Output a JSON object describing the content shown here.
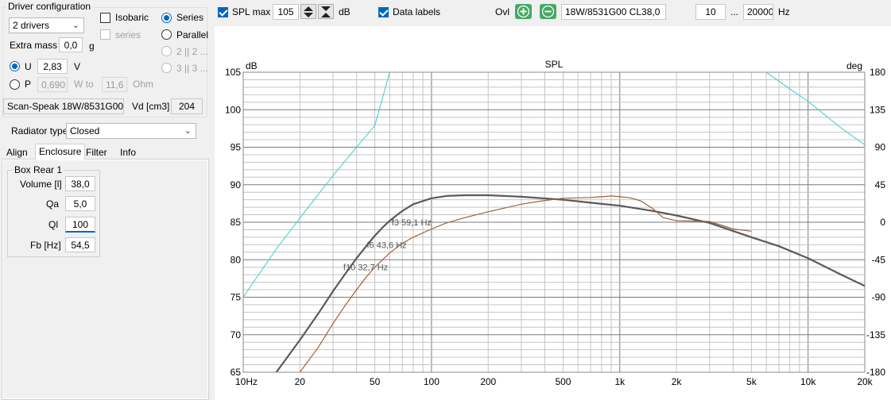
{
  "left_panel": {
    "driver_config": {
      "title": "Driver configuration",
      "drivers_combo": "2 drivers",
      "isobaric_label": "Isobaric",
      "series_sub_label": "series",
      "series_label": "Series",
      "parallel_label": "Parallel",
      "opt_2x2_label": "2 || 2 ...",
      "opt_3x3_label": "3 || 3 ...",
      "extra_mass_label": "Extra mass",
      "extra_mass_value": "0,0",
      "extra_mass_unit": "g",
      "u_label": "U",
      "u_value": "2,83",
      "u_unit": "V",
      "p_label": "P",
      "p_value": "0,690",
      "w_to_label": "W to",
      "ohm_value": "11,6",
      "ohm_unit": "Ohm"
    },
    "driver_name": "Scan-Speak 18W/8531G00",
    "vd_label": "Vd [cm3]",
    "vd_value": "204",
    "radiator_label": "Radiator type",
    "radiator_value": "Closed",
    "tabs": [
      "Align",
      "Enclosure",
      "Filter",
      "Info"
    ],
    "box": {
      "title": "Box Rear 1",
      "volume_label": "Volume [l]",
      "volume_value": "38,0",
      "qa_label": "Qa",
      "qa_value": "5,0",
      "ql_label": "Ql",
      "ql_value": "100",
      "fb_label": "Fb [Hz]",
      "fb_value": "54,5"
    }
  },
  "toolbar": {
    "spl_max_label": "SPL max",
    "spl_max_value": "105",
    "db_unit": "dB",
    "data_labels_label": "Data labels",
    "ovl_label": "Ovl",
    "overlay_name": "18W/8531G00 CL38,0",
    "freq_min": "10",
    "dots": "...",
    "freq_max": "20000",
    "hz_unit": "Hz"
  },
  "colors": {
    "spl_main": "#5a5a5a",
    "spl_overlay": "#a0603a",
    "phase": "#4dd0d0",
    "grid": "#c4c4c4",
    "grid_major": "#7a7a7a",
    "check_blue": "#0067c0",
    "btn_green": "#44aa66"
  },
  "chart_data": {
    "type": "line",
    "title": "SPL",
    "ylabel": "dB",
    "y2label": "deg",
    "x_scale": "log",
    "xlim": [
      10,
      20000
    ],
    "ylim": [
      65,
      105
    ],
    "y2lim": [
      -180,
      180
    ],
    "x_tick_labels": [
      {
        "v": 10,
        "t": "10Hz"
      },
      {
        "v": 20,
        "t": "20"
      },
      {
        "v": 50,
        "t": "50"
      },
      {
        "v": 100,
        "t": "100"
      },
      {
        "v": 200,
        "t": "200"
      },
      {
        "v": 500,
        "t": "500"
      },
      {
        "v": 1000,
        "t": "1k"
      },
      {
        "v": 2000,
        "t": "2k"
      },
      {
        "v": 5000,
        "t": "5k"
      },
      {
        "v": 10000,
        "t": "10k"
      },
      {
        "v": 20000,
        "t": "20k"
      }
    ],
    "y_ticks": [
      65,
      70,
      75,
      80,
      85,
      90,
      95,
      100,
      105
    ],
    "y2_ticks": [
      -180,
      -135,
      -90,
      -45,
      0,
      45,
      90,
      135,
      180
    ],
    "grid": true,
    "series": [
      {
        "axis": "left",
        "x": [
          15,
          20,
          25,
          30,
          35,
          40,
          45,
          50,
          55,
          60,
          70,
          80,
          100,
          120,
          150,
          200,
          300,
          500,
          700,
          1000,
          1500,
          2000,
          3000,
          5000,
          7000,
          10000,
          15000,
          20000
        ],
        "y": [
          65.0,
          69.3,
          72.8,
          75.8,
          78.2,
          80.2,
          81.8,
          83.2,
          84.3,
          85.2,
          86.5,
          87.4,
          88.2,
          88.5,
          88.6,
          88.6,
          88.4,
          88.0,
          87.6,
          87.2,
          86.5,
          85.9,
          84.9,
          83.0,
          81.8,
          80.2,
          78.0,
          76.5
        ]
      },
      {
        "axis": "left",
        "x": [
          20,
          25,
          30,
          35,
          40,
          45,
          50,
          60,
          70,
          80,
          100,
          120,
          150,
          200,
          300,
          400,
          500,
          700,
          800,
          900,
          1000,
          1100,
          1200,
          1300,
          1500,
          1700,
          2000,
          3000,
          4000,
          5000
        ],
        "y": [
          65.0,
          68.3,
          71.5,
          74.0,
          76.0,
          77.7,
          79.0,
          80.9,
          82.2,
          83.0,
          84.1,
          84.9,
          85.6,
          86.4,
          87.4,
          87.9,
          88.2,
          88.3,
          88.4,
          88.5,
          88.4,
          88.3,
          88.1,
          87.8,
          86.8,
          85.6,
          85.2,
          85.1,
          84.1,
          83.8
        ]
      },
      {
        "axis": "right",
        "x": [
          10,
          15,
          20,
          30,
          40,
          50,
          60
        ],
        "y": [
          -90,
          -32,
          5,
          56,
          90,
          116,
          180
        ]
      },
      {
        "axis": "right",
        "x": [
          6000,
          8000,
          10000,
          15000,
          20000
        ],
        "y": [
          180,
          160,
          145,
          113,
          93
        ]
      }
    ],
    "annotations": [
      {
        "x": 59.1,
        "y": 85,
        "text": "f3 59,1 Hz"
      },
      {
        "x": 43.6,
        "y": 82,
        "text": "f6 43,6 Hz"
      },
      {
        "x": 32.7,
        "y": 79,
        "text": "f10 32,7 Hz"
      }
    ]
  }
}
